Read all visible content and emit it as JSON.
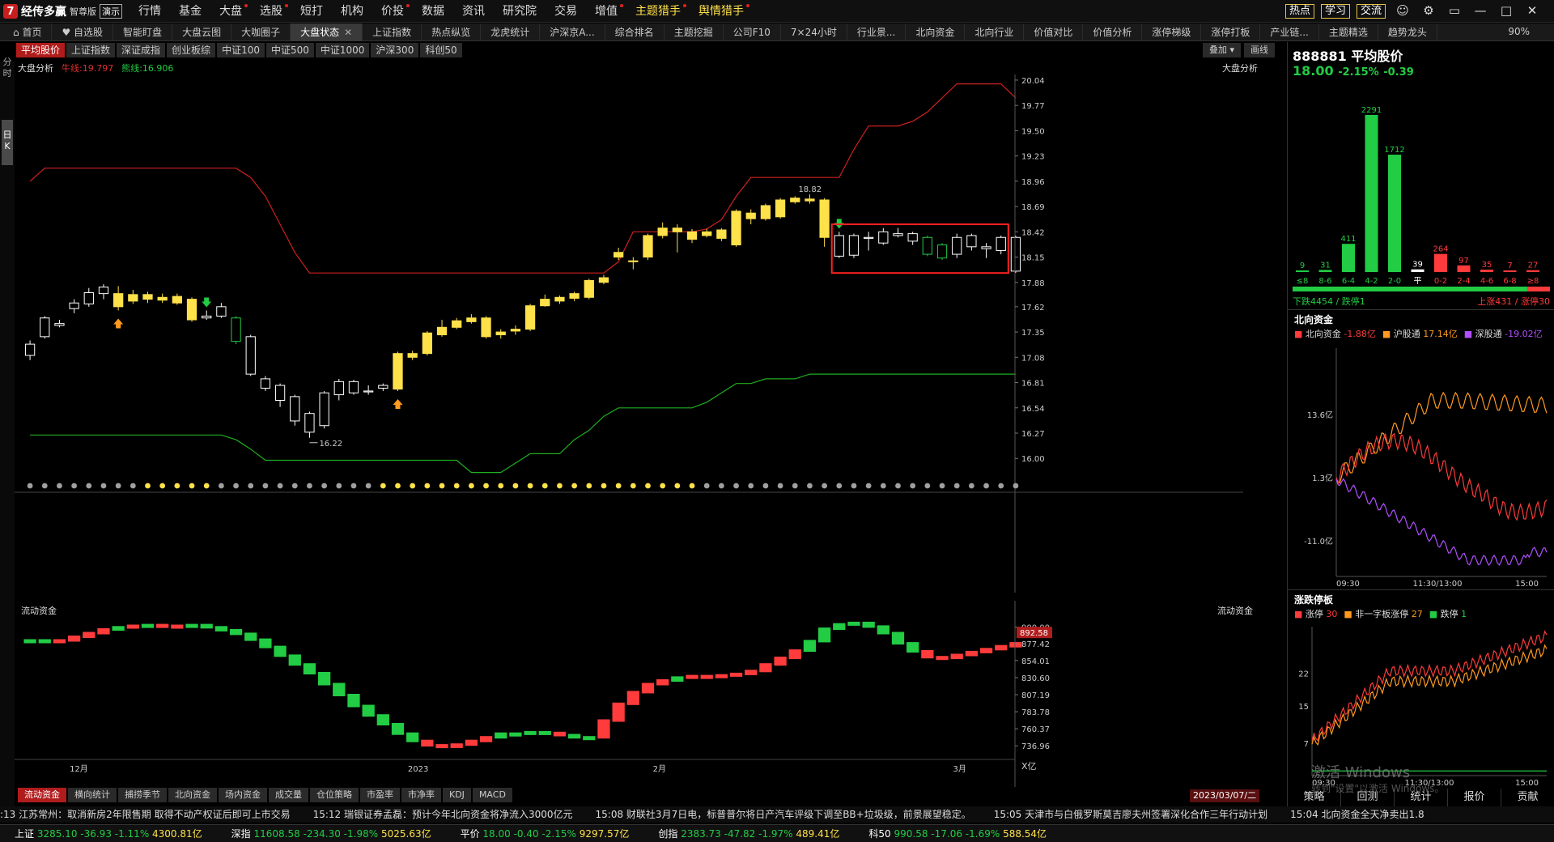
{
  "app": {
    "logo_mark": "7",
    "name": "经传多赢",
    "edition": "智尊版",
    "demo": "演示"
  },
  "menu": [
    {
      "label": "行情",
      "dot": false,
      "hl": false
    },
    {
      "label": "基金",
      "dot": false,
      "hl": false
    },
    {
      "label": "大盘",
      "dot": true,
      "hl": false
    },
    {
      "label": "选股",
      "dot": true,
      "hl": false
    },
    {
      "label": "短打",
      "dot": false,
      "hl": false
    },
    {
      "label": "机构",
      "dot": false,
      "hl": false
    },
    {
      "label": "价投",
      "dot": true,
      "hl": false
    },
    {
      "label": "数据",
      "dot": false,
      "hl": false
    },
    {
      "label": "资讯",
      "dot": false,
      "hl": false
    },
    {
      "label": "研究院",
      "dot": false,
      "hl": false
    },
    {
      "label": "交易",
      "dot": false,
      "hl": false
    },
    {
      "label": "增值",
      "dot": true,
      "hl": false
    },
    {
      "label": "主题猎手",
      "dot": true,
      "hl": true
    },
    {
      "label": "舆情猎手",
      "dot": true,
      "hl": true
    }
  ],
  "top_buttons": [
    "热点",
    "学习",
    "交流"
  ],
  "window_controls": {
    "user": "user-icon",
    "settings": "gear-icon",
    "min": "minimize-icon",
    "max": "maximize-icon",
    "close": "close-icon"
  },
  "tabs": [
    "首页",
    "自选股",
    "智能盯盘",
    "大盘云图",
    "大咖圈子",
    "大盘状态",
    "上证指数",
    "热点纵览",
    "龙虎统计",
    "沪深京A...",
    "综合排名",
    "主题挖掘",
    "公司F10",
    "7×24小时",
    "行业景...",
    "北向资金",
    "北向行业",
    "价值对比",
    "价值分析",
    "涨停梯级",
    "涨停打板",
    "产业链...",
    "主题精选",
    "趋势龙头"
  ],
  "active_tab": "大盘状态",
  "zoom": "90%",
  "index_buttons": [
    "平均股价",
    "上证指数",
    "深证成指",
    "创业板综",
    "中证100",
    "中证500",
    "中证1000",
    "沪深300",
    "科创50"
  ],
  "active_index": "平均股价",
  "overlay_buttons": [
    "叠加 ▾",
    "画线"
  ],
  "sidebar": [
    "分",
    "时",
    "日",
    "K"
  ],
  "main_header": {
    "title": "大盘分析",
    "bull": "牛线:19.797",
    "bear": "熊线:16.906",
    "right_label": "大盘分析"
  },
  "flow_header": {
    "title": "流动资金",
    "right_label": "流动资金",
    "unit": "X亿"
  },
  "chart_data": {
    "type": "candlestick",
    "y_ticks": [
      "20.04",
      "19.77",
      "19.50",
      "19.23",
      "18.96",
      "18.69",
      "18.42",
      "18.15",
      "17.88",
      "17.62",
      "17.35",
      "17.08",
      "16.81",
      "16.54",
      "16.27",
      "16.00"
    ],
    "ylim": [
      15.95,
      20.1
    ],
    "annotations": {
      "high": "18.82",
      "low": "16.22"
    },
    "x_labels": [
      "12月",
      "2023",
      "2月",
      "3月"
    ],
    "candles": [
      {
        "o": 17.1,
        "c": 17.22,
        "h": 17.26,
        "l": 17.05,
        "col": "w"
      },
      {
        "o": 17.3,
        "c": 17.5,
        "h": 17.52,
        "l": 17.28,
        "col": "w"
      },
      {
        "o": 17.42,
        "c": 17.44,
        "h": 17.48,
        "l": 17.4,
        "col": "w"
      },
      {
        "o": 17.6,
        "c": 17.66,
        "h": 17.7,
        "l": 17.55,
        "col": "w"
      },
      {
        "o": 17.65,
        "c": 17.77,
        "h": 17.82,
        "l": 17.62,
        "col": "w"
      },
      {
        "o": 17.76,
        "c": 17.83,
        "h": 17.86,
        "l": 17.7,
        "col": "w"
      },
      {
        "o": 17.62,
        "c": 17.76,
        "h": 17.84,
        "l": 17.58,
        "col": "y"
      },
      {
        "o": 17.68,
        "c": 17.75,
        "h": 17.8,
        "l": 17.65,
        "col": "y"
      },
      {
        "o": 17.7,
        "c": 17.75,
        "h": 17.78,
        "l": 17.66,
        "col": "y"
      },
      {
        "o": 17.69,
        "c": 17.72,
        "h": 17.76,
        "l": 17.66,
        "col": "y"
      },
      {
        "o": 17.66,
        "c": 17.73,
        "h": 17.76,
        "l": 17.64,
        "col": "y"
      },
      {
        "o": 17.7,
        "c": 17.48,
        "h": 17.72,
        "l": 17.46,
        "col": "y"
      },
      {
        "o": 17.52,
        "c": 17.5,
        "h": 17.58,
        "l": 17.48,
        "col": "w"
      },
      {
        "o": 17.52,
        "c": 17.62,
        "h": 17.66,
        "l": 17.5,
        "col": "w"
      },
      {
        "o": 17.5,
        "c": 17.25,
        "h": 17.52,
        "l": 17.22,
        "col": "g"
      },
      {
        "o": 17.3,
        "c": 16.9,
        "h": 17.32,
        "l": 16.88,
        "col": "w"
      },
      {
        "o": 16.85,
        "c": 16.75,
        "h": 16.88,
        "l": 16.72,
        "col": "w"
      },
      {
        "o": 16.78,
        "c": 16.62,
        "h": 16.8,
        "l": 16.55,
        "col": "w"
      },
      {
        "o": 16.66,
        "c": 16.4,
        "h": 16.68,
        "l": 16.35,
        "col": "w"
      },
      {
        "o": 16.48,
        "c": 16.28,
        "h": 16.5,
        "l": 16.22,
        "col": "w"
      },
      {
        "o": 16.35,
        "c": 16.7,
        "h": 16.72,
        "l": 16.32,
        "col": "w"
      },
      {
        "o": 16.68,
        "c": 16.82,
        "h": 16.85,
        "l": 16.62,
        "col": "w"
      },
      {
        "o": 16.7,
        "c": 16.82,
        "h": 16.84,
        "l": 16.68,
        "col": "w"
      },
      {
        "o": 16.71,
        "c": 16.72,
        "h": 16.78,
        "l": 16.68,
        "col": "w"
      },
      {
        "o": 16.75,
        "c": 16.78,
        "h": 16.8,
        "l": 16.72,
        "col": "w"
      },
      {
        "o": 16.74,
        "c": 17.12,
        "h": 17.14,
        "l": 16.72,
        "col": "y"
      },
      {
        "o": 17.08,
        "c": 17.12,
        "h": 17.15,
        "l": 17.05,
        "col": "y"
      },
      {
        "o": 17.12,
        "c": 17.34,
        "h": 17.36,
        "l": 17.1,
        "col": "y"
      },
      {
        "o": 17.32,
        "c": 17.4,
        "h": 17.48,
        "l": 17.3,
        "col": "y"
      },
      {
        "o": 17.4,
        "c": 17.47,
        "h": 17.5,
        "l": 17.38,
        "col": "y"
      },
      {
        "o": 17.46,
        "c": 17.5,
        "h": 17.54,
        "l": 17.44,
        "col": "y"
      },
      {
        "o": 17.5,
        "c": 17.3,
        "h": 17.52,
        "l": 17.28,
        "col": "y"
      },
      {
        "o": 17.32,
        "c": 17.35,
        "h": 17.38,
        "l": 17.28,
        "col": "y"
      },
      {
        "o": 17.36,
        "c": 17.38,
        "h": 17.42,
        "l": 17.32,
        "col": "y"
      },
      {
        "o": 17.38,
        "c": 17.63,
        "h": 17.65,
        "l": 17.36,
        "col": "y"
      },
      {
        "o": 17.63,
        "c": 17.7,
        "h": 17.75,
        "l": 17.62,
        "col": "y"
      },
      {
        "o": 17.68,
        "c": 17.72,
        "h": 17.74,
        "l": 17.65,
        "col": "y"
      },
      {
        "o": 17.71,
        "c": 17.76,
        "h": 17.78,
        "l": 17.68,
        "col": "y"
      },
      {
        "o": 17.72,
        "c": 17.9,
        "h": 17.92,
        "l": 17.7,
        "col": "y"
      },
      {
        "o": 17.88,
        "c": 17.93,
        "h": 17.96,
        "l": 17.86,
        "col": "y"
      },
      {
        "o": 18.15,
        "c": 18.2,
        "h": 18.25,
        "l": 18.12,
        "col": "y"
      },
      {
        "o": 18.1,
        "c": 18.11,
        "h": 18.15,
        "l": 18.02,
        "col": "y"
      },
      {
        "o": 18.15,
        "c": 18.38,
        "h": 18.4,
        "l": 18.12,
        "col": "y"
      },
      {
        "o": 18.38,
        "c": 18.46,
        "h": 18.52,
        "l": 18.35,
        "col": "y"
      },
      {
        "o": 18.42,
        "c": 18.46,
        "h": 18.5,
        "l": 18.2,
        "col": "y"
      },
      {
        "o": 18.34,
        "c": 18.42,
        "h": 18.45,
        "l": 18.3,
        "col": "y"
      },
      {
        "o": 18.38,
        "c": 18.42,
        "h": 18.45,
        "l": 18.36,
        "col": "y"
      },
      {
        "o": 18.35,
        "c": 18.44,
        "h": 18.46,
        "l": 18.32,
        "col": "y"
      },
      {
        "o": 18.28,
        "c": 18.64,
        "h": 18.66,
        "l": 18.26,
        "col": "y"
      },
      {
        "o": 18.56,
        "c": 18.62,
        "h": 18.66,
        "l": 18.5,
        "col": "y"
      },
      {
        "o": 18.56,
        "c": 18.7,
        "h": 18.72,
        "l": 18.54,
        "col": "y"
      },
      {
        "o": 18.58,
        "c": 18.76,
        "h": 18.78,
        "l": 18.56,
        "col": "y"
      },
      {
        "o": 18.74,
        "c": 18.78,
        "h": 18.8,
        "l": 18.72,
        "col": "y"
      },
      {
        "o": 18.75,
        "c": 18.77,
        "h": 18.82,
        "l": 18.72,
        "col": "y"
      },
      {
        "o": 18.76,
        "c": 18.36,
        "h": 18.78,
        "l": 18.26,
        "col": "y"
      },
      {
        "o": 18.16,
        "c": 18.38,
        "h": 18.42,
        "l": 18.14,
        "col": "w"
      },
      {
        "o": 18.17,
        "c": 18.38,
        "h": 18.4,
        "l": 18.14,
        "col": "w"
      },
      {
        "o": 18.35,
        "c": 18.36,
        "h": 18.42,
        "l": 18.22,
        "col": "w"
      },
      {
        "o": 18.3,
        "c": 18.42,
        "h": 18.46,
        "l": 18.28,
        "col": "w"
      },
      {
        "o": 18.38,
        "c": 18.4,
        "h": 18.46,
        "l": 18.36,
        "col": "w"
      },
      {
        "o": 18.4,
        "c": 18.32,
        "h": 18.42,
        "l": 18.28,
        "col": "w"
      },
      {
        "o": 18.36,
        "c": 18.18,
        "h": 18.38,
        "l": 18.16,
        "col": "g"
      },
      {
        "o": 18.28,
        "c": 18.14,
        "h": 18.3,
        "l": 18.12,
        "col": "g"
      },
      {
        "o": 18.18,
        "c": 18.36,
        "h": 18.4,
        "l": 18.14,
        "col": "w"
      },
      {
        "o": 18.38,
        "c": 18.26,
        "h": 18.4,
        "l": 18.22,
        "col": "w"
      },
      {
        "o": 18.26,
        "c": 18.24,
        "h": 18.3,
        "l": 18.14,
        "col": "w"
      },
      {
        "o": 18.22,
        "c": 18.36,
        "h": 18.38,
        "l": 18.18,
        "col": "w"
      },
      {
        "o": 18.36,
        "c": 18.0,
        "h": 18.38,
        "l": 17.98,
        "col": "w"
      }
    ],
    "bull_line": [
      18.96,
      19.1,
      19.1,
      19.1,
      19.1,
      19.1,
      19.1,
      19.1,
      19.1,
      19.1,
      19.1,
      19.1,
      19.1,
      19.1,
      19.1,
      19.0,
      18.8,
      18.5,
      18.2,
      17.98,
      17.98,
      17.98,
      17.98,
      17.98,
      17.98,
      17.98,
      17.98,
      17.98,
      17.98,
      17.98,
      17.98,
      17.98,
      17.98,
      17.98,
      17.98,
      17.98,
      17.98,
      17.98,
      17.98,
      17.98,
      18.1,
      18.42,
      18.42,
      18.42,
      18.42,
      18.42,
      18.45,
      18.55,
      18.8,
      19.0,
      19.0,
      19.0,
      19.0,
      19.0,
      19.0,
      19.0,
      19.3,
      19.55,
      19.55,
      19.55,
      19.6,
      19.7,
      19.85,
      20.0,
      20.0,
      20.0,
      20.0,
      19.85
    ],
    "bear_line": [
      16.25,
      16.25,
      16.25,
      16.25,
      16.25,
      16.25,
      16.25,
      16.25,
      16.25,
      16.25,
      16.25,
      16.25,
      16.25,
      16.25,
      16.2,
      16.1,
      15.98,
      15.98,
      15.98,
      15.98,
      15.98,
      15.98,
      15.98,
      15.98,
      15.98,
      15.98,
      15.98,
      15.98,
      15.98,
      15.98,
      15.85,
      15.85,
      15.85,
      15.95,
      16.05,
      16.05,
      16.05,
      16.2,
      16.3,
      16.45,
      16.54,
      16.54,
      16.54,
      16.54,
      16.54,
      16.54,
      16.6,
      16.7,
      16.8,
      16.8,
      16.85,
      16.85,
      16.85,
      16.9,
      16.9,
      16.9,
      16.9,
      16.9,
      16.9,
      16.9,
      16.9,
      16.9,
      16.9,
      16.9,
      16.9,
      16.9,
      16.9,
      16.9
    ],
    "dots": "wwwwwwwwyyyyywwwwwwwwwwwyyyyyyyyyyyyyyyyyyyyyywwwwwwwwwwwwwwwwwwwwwww",
    "arrows": [
      {
        "i": 6,
        "dir": "up"
      },
      {
        "i": 12,
        "dir": "down"
      },
      {
        "i": 25,
        "dir": "up"
      },
      {
        "i": 55,
        "dir": "down"
      }
    ],
    "selection": {
      "from": 55,
      "to": 66,
      "yhi": 18.5,
      "ylo": 17.98
    },
    "flow": {
      "y_ticks": [
        "900.00",
        "877.42",
        "854.01",
        "830.60",
        "807.19",
        "783.78",
        "760.37",
        "736.96"
      ],
      "ylim": [
        725,
        905
      ],
      "last_value": "892.58",
      "values": [
        880,
        878,
        880,
        885,
        890,
        895,
        898,
        900,
        901,
        900,
        900,
        901,
        898,
        894,
        889,
        881,
        871,
        859,
        847,
        835,
        820,
        805,
        790,
        777,
        765,
        752,
        742,
        736,
        734,
        737,
        742,
        747,
        752,
        752,
        754,
        753,
        750,
        747,
        747,
        770,
        793,
        809,
        820,
        825,
        829,
        831,
        831,
        832,
        834,
        838,
        847,
        856,
        866,
        879,
        896,
        902,
        904,
        899,
        890,
        876,
        865,
        857,
        856,
        860,
        864,
        868,
        872,
        876
      ],
      "colors": "ggrrrrgrgrrggggggggggggggggrrrrrggggrggrrrrrgrrrrrrrrggggggggrrrrrrr"
    }
  },
  "bottom_tabs": [
    "流动资金",
    "横向统计",
    "捕捞季节",
    "北向资金",
    "场内资金",
    "成交量",
    "仓位策略",
    "市盈率",
    "市净率",
    "KDJ",
    "MACD"
  ],
  "active_bottom": "流动资金",
  "date_badge": "2023/03/07/二",
  "right_panel": {
    "code_name": "888881 平均股价",
    "price": "18.00",
    "pct": "-2.15%",
    "chg": "-0.39",
    "dist": {
      "labels": [
        "≤8",
        "8-6",
        "6-4",
        "4-2",
        "2-0",
        "平",
        "0-2",
        "2-4",
        "4-6",
        "6-8",
        "≥8"
      ],
      "values": [
        9,
        31,
        411,
        2291,
        1712,
        39,
        264,
        97,
        35,
        7,
        27
      ],
      "colors": [
        "#22cc44",
        "#22cc44",
        "#22cc44",
        "#22cc44",
        "#22cc44",
        "#ffffff",
        "#ff3b3b",
        "#ff3b3b",
        "#ff3b3b",
        "#ff3b3b",
        "#ff3b3b"
      ],
      "down_text": "下跌4454 / 跌停1",
      "up_text": "上涨431 / 涨停30"
    },
    "north": {
      "title": "北向资金",
      "legend": [
        {
          "name": "北向资金",
          "val": "-1.88亿",
          "color": "#ff3b3b"
        },
        {
          "name": "沪股通",
          "val": "17.14亿",
          "color": "#ff9a1f"
        },
        {
          "name": "深股通",
          "val": "-19.02亿",
          "color": "#b050ff"
        }
      ],
      "y_ticks": [
        "13.6亿",
        "1.3亿",
        "-11.0亿"
      ],
      "x_ticks": [
        "09:30",
        "11:30/13:00",
        "15:00"
      ]
    },
    "limit": {
      "title": "涨跌停板",
      "legend": [
        {
          "name": "涨停",
          "val": "30",
          "color": "#ff3b3b"
        },
        {
          "name": "非一字板涨停",
          "val": "27",
          "color": "#ff9a1f"
        },
        {
          "name": "跌停",
          "val": "1",
          "color": "#22cc44"
        }
      ],
      "y_ticks": [
        "22",
        "15",
        "7"
      ],
      "x_ticks": [
        "09:30",
        "11:30/13:00",
        "15:00"
      ]
    },
    "tabs": [
      "策略",
      "回测",
      "统计",
      "报价",
      "贡献"
    ]
  },
  "watermark": {
    "line1": "激活 Windows",
    "line2": "转到\"设置\"以激活 Windows。"
  },
  "news": [
    ":13 江苏常州：取消新房2年限售期 取得不动产权证后即可上市交易",
    "15:12 瑞银证券孟磊：预计今年北向资金将净流入3000亿元",
    "15:08 财联社3月7日电，标普普尔将日产汽车评级下调至BB+垃圾级，前景展望稳定。",
    "15:05 天津市与白俄罗斯莫吉廖夫州签署深化合作三年行动计划",
    "15:04 北向资金全天净卖出1.8"
  ],
  "status": [
    {
      "name": "上证",
      "price": "3285.10",
      "chg": "-36.93",
      "pct": "-1.11%",
      "amt": "4300.81亿"
    },
    {
      "name": "深指",
      "price": "11608.58",
      "chg": "-234.30",
      "pct": "-1.98%",
      "amt": "5025.63亿"
    },
    {
      "name": "平价",
      "price": "18.00",
      "chg": "-0.40",
      "pct": "-2.15%",
      "amt": "9297.57亿"
    },
    {
      "name": "创指",
      "price": "2383.73",
      "chg": "-47.82",
      "pct": "-1.97%",
      "amt": "489.41亿"
    },
    {
      "name": "科50",
      "price": "990.58",
      "chg": "-17.06",
      "pct": "-1.69%",
      "amt": "588.54亿"
    }
  ],
  "colors": {
    "up": "#ff3b3b",
    "down": "#22cc44",
    "yellow": "#ffe14a",
    "bull": "#d02020",
    "bear": "#1fae1f",
    "panel_red": "#b01c1c"
  }
}
